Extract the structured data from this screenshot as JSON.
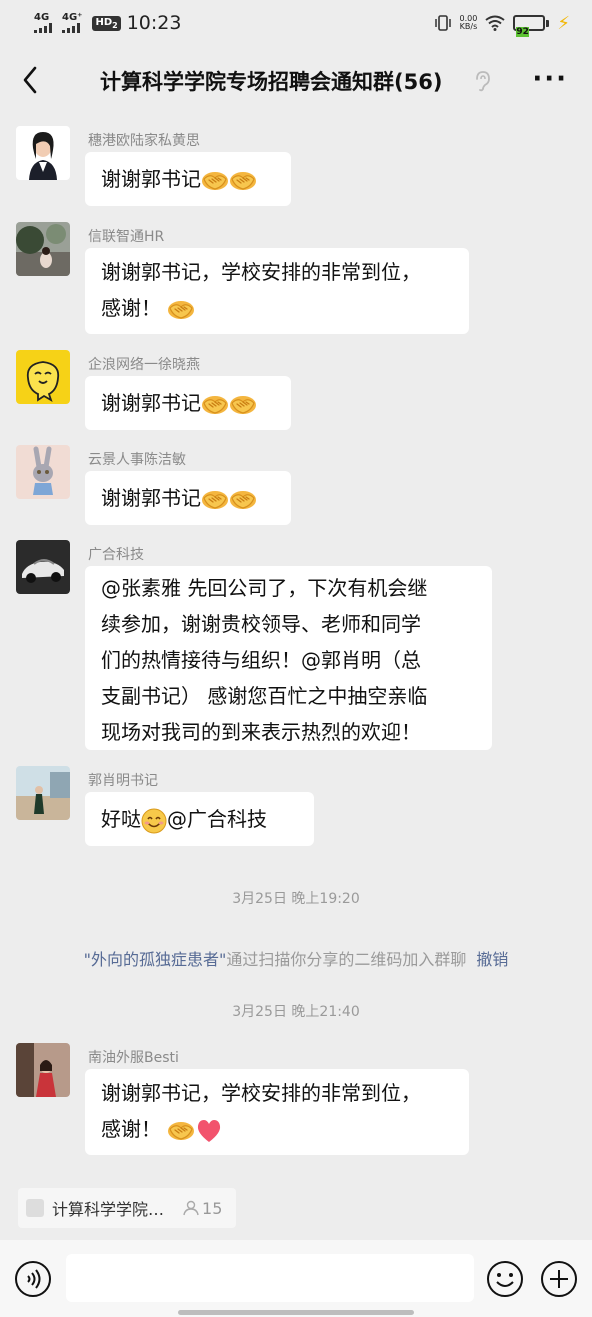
{
  "status": {
    "sim1": "4G",
    "sim2": "4G⁺",
    "hd": "HD",
    "hd_sub": "2",
    "time": "10:23",
    "speed_value": "0.00",
    "speed_unit": "KB/s",
    "battery": "92",
    "battery_level": 0.92,
    "battery_color": "#5cc232"
  },
  "nav": {
    "title": "计算科学学院专场招聘会通知群(56)",
    "more": "···"
  },
  "messages": [
    {
      "sender": "穗港欧陆家私黄思",
      "text": "谢谢郭书记",
      "emojis": [
        "handshake-icon",
        "handshake-icon"
      ]
    },
    {
      "sender": "信联智通HR",
      "line1": "谢谢郭书记，学校安排的非常到位，",
      "line2": "感谢！",
      "emojis": [
        "handshake-icon"
      ]
    },
    {
      "sender": "企浪网络一徐晓燕",
      "text": "谢谢郭书记",
      "emojis": [
        "handshake-icon",
        "handshake-icon"
      ]
    },
    {
      "sender": "云景人事陈洁敏",
      "text": "谢谢郭书记",
      "emojis": [
        "handshake-icon",
        "handshake-icon"
      ]
    },
    {
      "sender": "广合科技",
      "lines": [
        "@张素雅  先回公司了，下次有机会继",
        "续参加，谢谢贵校领导、老师和同学",
        "们的热情接待与组织！@郭肖明（总",
        "支副书记） 感谢您百忙之中抽空亲临",
        "现场对我司的到来表示热烈的欢迎！"
      ]
    },
    {
      "sender": "郭肖明书记",
      "text_before": "好哒",
      "text_after": "@广合科技",
      "emojis": [
        "smile-icon"
      ]
    }
  ],
  "timestamp1": "3月25日 晚上19:20",
  "system": {
    "name": "\"外向的孤独症患者\"",
    "text": "通过扫描你分享的二维码加入群聊",
    "action": "撤销"
  },
  "timestamp2": "3月25日 晚上21:40",
  "last_message": {
    "sender": "南油外服Besti",
    "line1": "谢谢郭书记，学校安排的非常到位，",
    "line2": "感谢！",
    "emojis": [
      "handshake-icon",
      "heart-icon"
    ]
  },
  "pinned": {
    "label": "计算科学学院…",
    "count": "15"
  },
  "colors": {
    "background": "#ededed",
    "link": "#576b95",
    "bubble": "#ffffff"
  }
}
